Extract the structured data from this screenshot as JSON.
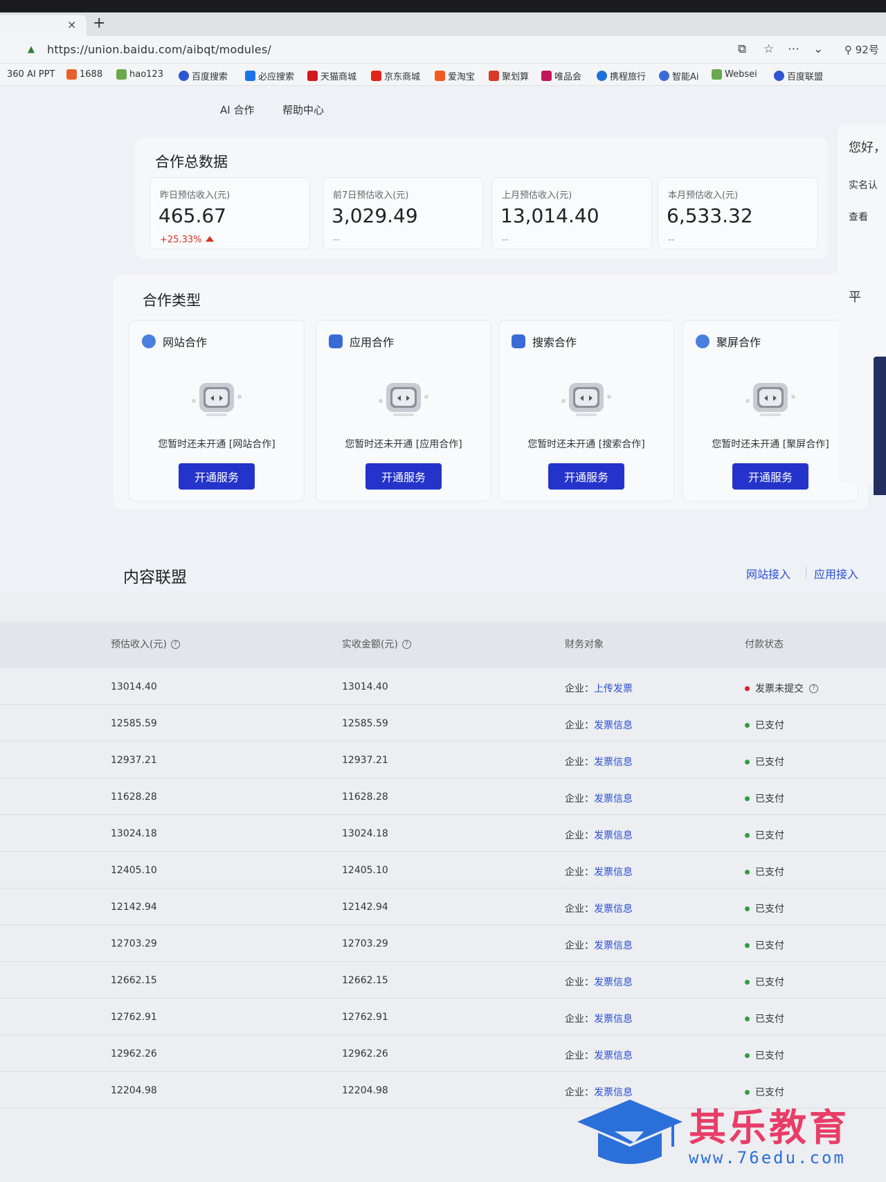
{
  "browser": {
    "tab_close": "×",
    "new_tab": "+",
    "url": "https://union.baidu.com/aibqt/modules/",
    "search_zone": "92号",
    "bookmarks": [
      "360 AI PPT",
      "1688",
      "hao123",
      "百度搜索",
      "必应搜索",
      "天猫商城",
      "京东商城",
      "爱淘宝",
      "聚划算",
      "唯品会",
      "携程旅行",
      "智能Ai",
      "Websei",
      "百度联盟"
    ]
  },
  "nav": {
    "items": [
      "AI 合作",
      "帮助中心"
    ]
  },
  "summary": {
    "title": "合作总数据",
    "stats": [
      {
        "label": "昨日预估收入(元)",
        "value": "465.67",
        "change": "+25.33%"
      },
      {
        "label": "前7日预估收入(元)",
        "value": "3,029.49",
        "change": "--"
      },
      {
        "label": "上月预估收入(元)",
        "value": "13,014.40",
        "change": "--"
      },
      {
        "label": "本月预估收入(元)",
        "value": "6,533.32",
        "change": "--"
      }
    ]
  },
  "coop": {
    "title": "合作类型",
    "button_label": "开通服务",
    "items": [
      {
        "name": "网站合作",
        "empty": "您暂时还未开通 [网站合作]"
      },
      {
        "name": "应用合作",
        "empty": "您暂时还未开通 [应用合作]"
      },
      {
        "name": "搜索合作",
        "empty": "您暂时还未开通 [搜索合作]"
      },
      {
        "name": "聚屏合作",
        "empty": "您暂时还未开通 [聚屏合作]"
      }
    ]
  },
  "right": {
    "greeting": "您好，",
    "verify": "实名认",
    "view": "查看",
    "platform": "平"
  },
  "content": {
    "title": "内容联盟",
    "link_site": "网站接入",
    "link_app": "应用接入"
  },
  "table": {
    "headers": {
      "estimated": "预估收入(元)",
      "received": "实收金额(元)",
      "finance": "财务对象",
      "status": "付款状态"
    },
    "entity_prefix": "企业：",
    "rows": [
      {
        "estimated": "13014.40",
        "received": "13014.40",
        "link": "上传发票",
        "status": "发票未提交",
        "status_type": "pending"
      },
      {
        "estimated": "12585.59",
        "received": "12585.59",
        "link": "发票信息",
        "status": "已支付",
        "status_type": "paid"
      },
      {
        "estimated": "12937.21",
        "received": "12937.21",
        "link": "发票信息",
        "status": "已支付",
        "status_type": "paid"
      },
      {
        "estimated": "11628.28",
        "received": "11628.28",
        "link": "发票信息",
        "status": "已支付",
        "status_type": "paid"
      },
      {
        "estimated": "13024.18",
        "received": "13024.18",
        "link": "发票信息",
        "status": "已支付",
        "status_type": "paid"
      },
      {
        "estimated": "12405.10",
        "received": "12405.10",
        "link": "发票信息",
        "status": "已支付",
        "status_type": "paid"
      },
      {
        "estimated": "12142.94",
        "received": "12142.94",
        "link": "发票信息",
        "status": "已支付",
        "status_type": "paid"
      },
      {
        "estimated": "12703.29",
        "received": "12703.29",
        "link": "发票信息",
        "status": "已支付",
        "status_type": "paid"
      },
      {
        "estimated": "12662.15",
        "received": "12662.15",
        "link": "发票信息",
        "status": "已支付",
        "status_type": "paid"
      },
      {
        "estimated": "12762.91",
        "received": "12762.91",
        "link": "发票信息",
        "status": "已支付",
        "status_type": "paid"
      },
      {
        "estimated": "12962.26",
        "received": "12962.26",
        "link": "发票信息",
        "status": "已支付",
        "status_type": "paid"
      },
      {
        "estimated": "12204.98",
        "received": "12204.98",
        "link": "发票信息",
        "status": "已支付",
        "status_type": "paid"
      }
    ]
  },
  "watermark": {
    "title": "其乐教育",
    "url": "www.76edu.com"
  },
  "colors": {
    "primary_button": "#2433c9",
    "link": "#2a4ed6",
    "paid": "#2e9e3e",
    "pending": "#d32020",
    "up": "#d93026",
    "watermark_pink": "#e83d67",
    "watermark_blue": "#2b6fd9"
  }
}
